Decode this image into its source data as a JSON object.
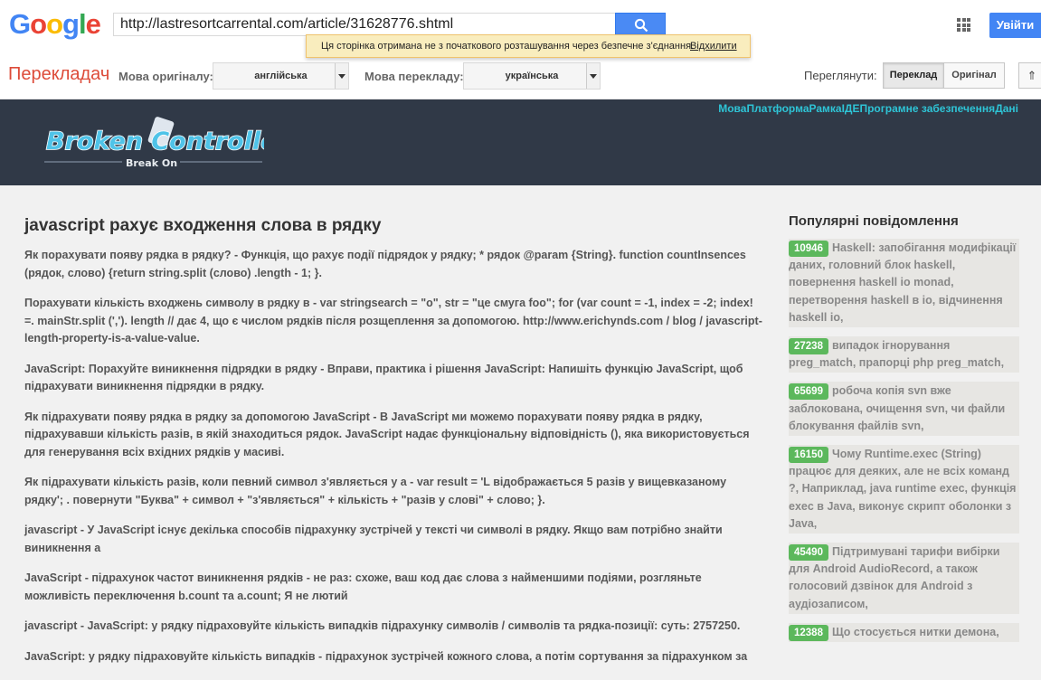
{
  "google": {
    "logo_letters": [
      "G",
      "o",
      "o",
      "g",
      "l",
      "e"
    ],
    "url_value": "http://lastresortcarrental.com/article/31628776.shtml",
    "signin_label": "Увійти",
    "notice_text": "Ця сторінка отримана не з початкового розташування через безпечне з'єднання.",
    "notice_link": "Відхилити"
  },
  "translate_bar": {
    "title": "Перекладач",
    "source_label": "Мова оригіналу:",
    "source_value": "англійська",
    "target_label": "Мова перекладу:",
    "target_value": "українська",
    "view_label": "Переглянути:",
    "view_translation": "Переклад",
    "view_original": "Оригінал",
    "collapse_glyph": "⇑"
  },
  "site": {
    "logo_text": "Broken Controllers",
    "logo_tagline": "Break On",
    "nav_items": [
      "Мова",
      "Платформа",
      "Рамка",
      "IДЕ",
      "Програмне забезпечення",
      "Дані"
    ]
  },
  "article": {
    "title": "javascript рахує входження слова в рядку",
    "paragraphs": [
      "Як порахувати появу рядка в рядку? - Функція, що рахує події підрядок у рядку; * рядок @param {String}. function countInsences (рядок, слово) {return string.split (слово) .length - 1; }.",
      "Порахувати кількість входжень символу в рядку в - var stringsearch = \"o\", str = \"це смуга foo\"; for (var count = -1, index = -2; index! =. mainStr.split (','). length // дає 4, що є числом рядків після розщеплення за допомогою. http://www.erichynds.com / blog / javascript-length-property-is-a-value-value.",
      "JavaScript: Порахуйте виникнення підрядки в рядку - Вправи, практика і рішення JavaScript: Напишіть функцію JavaScript, щоб підрахувати виникнення підрядки в рядку.",
      "Як підрахувати появу рядка в рядку за допомогою JavaScript - В JavaScript ми можемо порахувати появу рядка в рядку, підрахувавши кількість разів, в якій знаходиться рядок. JavaScript надає функціональну відповідність (), яка використовується для генерування всіх вхідних рядків у масиві.",
      "Як підрахувати кількість разів, коли певний символ з'являється у а - var result = 'L відображається 5 разів у вищевказаному рядку'; . повернути \"Буква\" + символ + \"з'являється\" + кількість + \"разів у слові\" + слово; }.",
      "javascript - У JavaScript існує декілька способів підрахунку зустрічей у тексті чи символі в рядку. Якщо вам потрібно знайти виникнення а",
      "JavaScript - підрахунок частот виникнення рядків - не раз: схоже, ваш код дає слова з найменшими подіями, розгляньте можливість переключення b.count та a.count; Я не лютий",
      "javascript - JavaScript: у рядку підраховуйте кількість випадків підрахунку символів / символів та рядка-позиції: суть: 2757250.",
      "JavaScript: у рядку підраховуйте кількість випадків - підрахунок зустрічей кожного слова, а потім сортування за підрахунком за"
    ]
  },
  "sidebar": {
    "title": "Популярні повідомлення",
    "posts": [
      {
        "count": "10946",
        "text": "Haskell: запобігання модифікації даних, головний блок haskell, повернення haskell io monad, перетворення haskell в io, відчинення haskell io,"
      },
      {
        "count": "27238",
        "text": "випадок ігнорування preg_match, прапорці php preg_match,"
      },
      {
        "count": "65699",
        "text": "робоча копія svn вже заблокована, очищення svn, чи файли блокування файлів svn,"
      },
      {
        "count": "16150",
        "text": "Чому Runtime.exec (String) працює для деяких, але не всіх команд ?, Наприклад, java runtime exec, функція exec в Java, виконує скрипт оболонки з Java,"
      },
      {
        "count": "45490",
        "text": "Підтримувані тарифи вибірки для Android AudioRecord, а також голосовий дзвінок для Android з аудіозаписом,"
      },
      {
        "count": "12388",
        "text": "Що стосується нитки демона,"
      }
    ]
  },
  "colors": {
    "google_blue": "#4285f4",
    "translate_red": "#dd4b39",
    "site_header": "#303947",
    "nav_cyan": "#2ec4d6",
    "badge_green": "#5cb85c"
  }
}
